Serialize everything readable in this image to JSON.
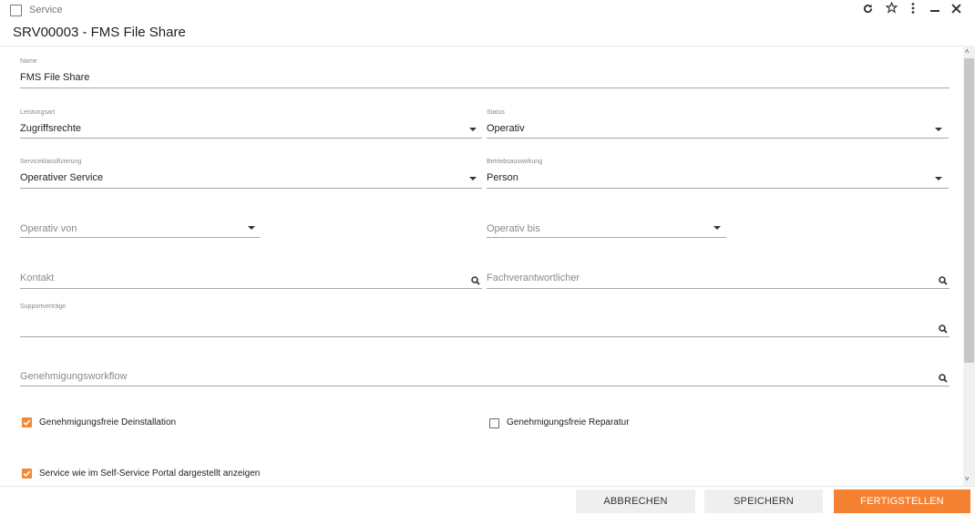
{
  "window": {
    "title": "Service"
  },
  "header": {
    "title": "SRV00003 - FMS File Share"
  },
  "form": {
    "name": {
      "label": "Name",
      "value": "FMS File Share"
    },
    "leistungsart": {
      "label": "Leistungsart",
      "value": "Zugriffsrechte"
    },
    "status": {
      "label": "Status",
      "value": "Operativ"
    },
    "serviceklassifizierung": {
      "label": "Serviceklassifizierung",
      "value": "Operativer Service"
    },
    "betriebsauswirkung": {
      "label": "Betriebsauswirkung",
      "value": "Person"
    },
    "operativ_von": {
      "placeholder": "Operativ von"
    },
    "operativ_bis": {
      "placeholder": "Operativ bis"
    },
    "kontakt": {
      "placeholder": "Kontakt"
    },
    "fachverantwortlicher": {
      "placeholder": "Fachverantwortlicher"
    },
    "supportvertraege": {
      "label": "Supportverträge"
    },
    "genehmigungsworkflow": {
      "placeholder": "Genehmigungsworkflow"
    },
    "checkbox_deinstallation": {
      "label": "Genehmigungsfreie Deinstallation",
      "checked": true
    },
    "checkbox_reparatur": {
      "label": "Genehmigungsfreie Reparatur",
      "checked": false
    },
    "checkbox_portal": {
      "label": "Service wie im Self-Service Portal dargestellt anzeigen",
      "checked": true
    }
  },
  "footer": {
    "cancel_label": "ABBRECHEN",
    "save_label": "SPEICHERN",
    "finish_label": "FERTIGSTELLEN"
  },
  "icons": {
    "refresh": "refresh-icon",
    "star": "star-icon",
    "more": "more-vertical-icon",
    "minimize": "minimize-icon",
    "close": "close-icon",
    "search": "search-icon",
    "dropdown": "caret-down-icon"
  },
  "colors": {
    "accent": "#f58232",
    "checkbox": "#f08a3a"
  }
}
